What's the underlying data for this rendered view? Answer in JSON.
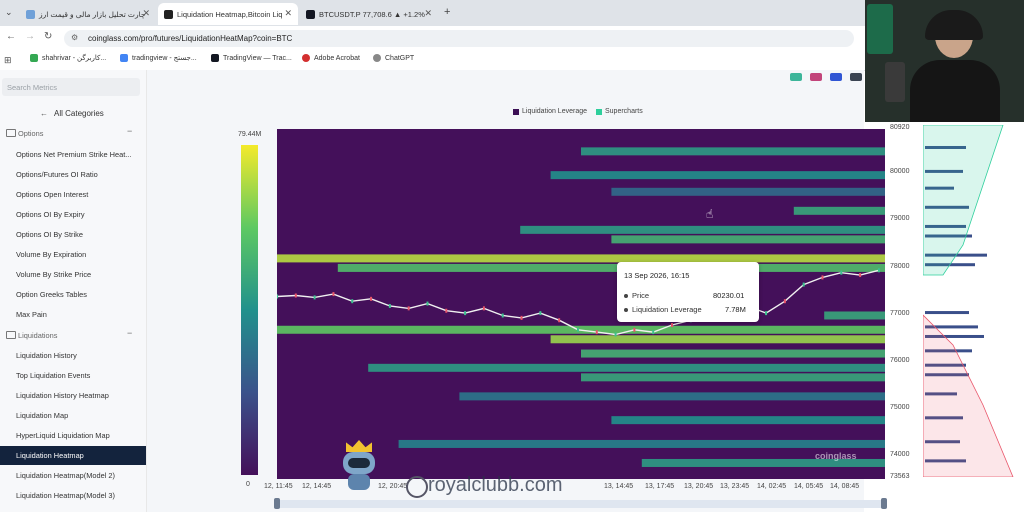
{
  "browser": {
    "tabs": [
      {
        "label": "چارت تحلیل بازار مالی و قیمت ارز"
      },
      {
        "label": "Liquidation Heatmap,Bitcoin Liq"
      },
      {
        "label": "BTCUSDT.P 77,708.6 ▲ +1.2% "
      }
    ],
    "url": "coinglass.com/pro/futures/LiquidationHeatMap?coin=BTC",
    "bookmarks": [
      "shahrivar - کاربرگن...",
      "tradingview - جستج...",
      "TradingView — Trac...",
      "Adobe Acrobat",
      "ChatGPT"
    ]
  },
  "sidebar": {
    "search_placeholder": "Search Metrics",
    "all_categories": "All Categories",
    "sections": [
      {
        "title": "Options",
        "items": [
          "Options Net Premium Strike Heat...",
          "Options/Futures OI Ratio",
          "Options Open Interest",
          "Options OI By Expiry",
          "Options OI By Strike",
          "Volume By Expiration",
          "Volume By Strike Price",
          "Option Greeks Tables",
          "Max Pain"
        ]
      },
      {
        "title": "Liquidations",
        "items": [
          "Liquidation History",
          "Top Liquidation Events",
          "Liquidation History Heatmap",
          "Liquidation Map",
          "HyperLiquid Liquidation Map",
          "Liquidation Heatmap",
          "Liquidation Heatmap(Model 2)",
          "Liquidation Heatmap(Model 3)"
        ]
      }
    ],
    "active_item": "Liquidation Heatmap"
  },
  "chart_data": {
    "type": "heatmap",
    "legend": [
      {
        "name": "Liquidation Leverage",
        "color": "#3b0f55"
      },
      {
        "name": "Supercharts",
        "color": "#2ecf9c"
      }
    ],
    "colorbar": {
      "max_label": "79.44M",
      "min_label": "0"
    },
    "y_ticks": [
      "80920",
      "80000",
      "79000",
      "78000",
      "77000",
      "76000",
      "75000",
      "74000",
      "73563"
    ],
    "ylim": [
      73563,
      80920
    ],
    "x_ticks": [
      "12, 11:45",
      "12, 14:45",
      "12, 20:45",
      "13, 14:45",
      "13, 17:45",
      "13, 20:45",
      "13, 23:45",
      "14, 02:45",
      "14, 05:45",
      "14, 08:45"
    ],
    "bands": [
      {
        "price": 80450,
        "intensity": 0.55,
        "start": 0.5
      },
      {
        "price": 79950,
        "intensity": 0.5,
        "start": 0.45
      },
      {
        "price": 79600,
        "intensity": 0.35,
        "start": 0.55
      },
      {
        "price": 79200,
        "intensity": 0.6,
        "start": 0.85
      },
      {
        "price": 78800,
        "intensity": 0.55,
        "start": 0.4
      },
      {
        "price": 78600,
        "intensity": 0.65,
        "start": 0.55
      },
      {
        "price": 78200,
        "intensity": 0.9,
        "start": 0.0
      },
      {
        "price": 78000,
        "intensity": 0.7,
        "start": 0.1
      },
      {
        "price": 77000,
        "intensity": 0.6,
        "start": 0.9
      },
      {
        "price": 76700,
        "intensity": 0.75,
        "start": 0.0
      },
      {
        "price": 76500,
        "intensity": 0.85,
        "start": 0.45
      },
      {
        "price": 76200,
        "intensity": 0.65,
        "start": 0.5
      },
      {
        "price": 75900,
        "intensity": 0.55,
        "start": 0.15
      },
      {
        "price": 75700,
        "intensity": 0.6,
        "start": 0.5
      },
      {
        "price": 75300,
        "intensity": 0.4,
        "start": 0.3
      },
      {
        "price": 74800,
        "intensity": 0.5,
        "start": 0.55
      },
      {
        "price": 74300,
        "intensity": 0.45,
        "start": 0.2
      },
      {
        "price": 73900,
        "intensity": 0.55,
        "start": 0.6
      }
    ],
    "price_series": [
      77400,
      77420,
      77380,
      77450,
      77300,
      77350,
      77200,
      77150,
      77250,
      77100,
      77050,
      77150,
      77000,
      76950,
      77050,
      76900,
      76700,
      76650,
      76600,
      76700,
      76650,
      76800,
      76900,
      76950,
      77100,
      77200,
      77050,
      77300,
      77650,
      77800,
      77900,
      77850,
      77950
    ],
    "tooltip": {
      "date": "13 Sep 2026, 16:15",
      "price_label": "Price",
      "price_value": "80230.01",
      "lev_label": "Liquidation Leverage",
      "lev_value": "7.78M"
    },
    "watermark": "coinglass"
  },
  "overlay": {
    "watermark": "royalclubb.com"
  }
}
